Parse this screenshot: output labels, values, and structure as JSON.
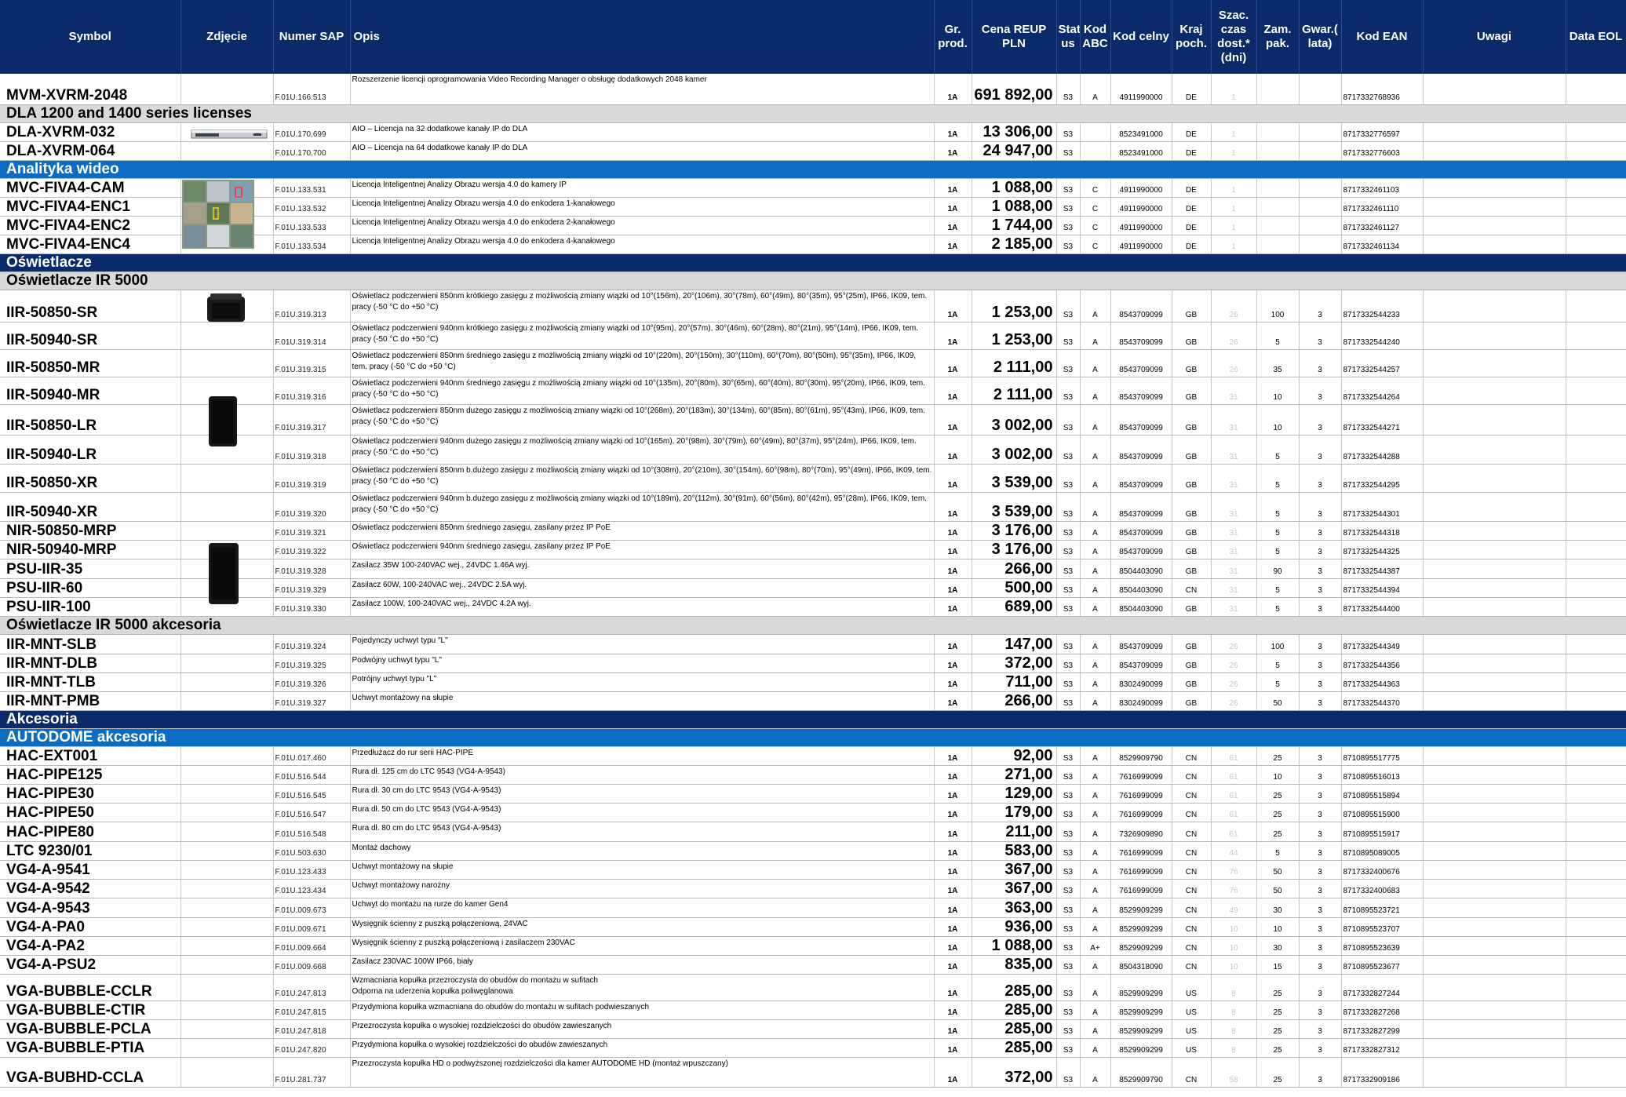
{
  "header": {
    "symbol": "Symbol",
    "photo": "Zdjęcie",
    "sap": "Numer SAP",
    "desc": "Opis",
    "group": "Gr. prod.",
    "price": "Cena REUP PLN",
    "status": "Stat us",
    "abc": "Kod ABC",
    "customs": "Kod celny",
    "country": "Kraj poch.",
    "delivery": "Szac. czas dost.* (dni)",
    "pack": "Zam. pak.",
    "warranty": "Gwar.( lata)",
    "ean": "Kod EAN",
    "notes": "Uwagi",
    "eol": "Data EOL"
  },
  "rows": [
    {
      "type": "item",
      "h": 39,
      "symbol": "MVM-XVRM-2048",
      "sap": "F.01U.166.513",
      "desc": "Rozszerzenie licencji oprogramowania Video Recording Manager o obsługę dodatkowych 2048 kamer",
      "group": "1A",
      "price": "691 892,00",
      "status": "S3",
      "abc": "A",
      "customs": "4911990000",
      "country": "DE",
      "delivery": "1",
      "pack": "",
      "warranty": "",
      "ean": "8717332768936"
    },
    {
      "type": "sec-grey",
      "h": 21,
      "label": "DLA 1200 and 1400 series licenses"
    },
    {
      "type": "item",
      "h": 24,
      "symbol": "DLA-XVRM-032",
      "sap": "F.01U.170.699",
      "desc": "AIO – Licencja na 32 dodatkowe kanały IP do DLA",
      "group": "1A",
      "price": "13 306,00",
      "status": "S3",
      "abc": "",
      "customs": "8523491000",
      "country": "DE",
      "delivery": "1",
      "pack": "",
      "warranty": "",
      "ean": "8717332776597"
    },
    {
      "type": "item",
      "h": 24,
      "symbol": "DLA-XVRM-064",
      "sap": "F.01U.170.700",
      "desc": "AIO – Licencja na 64 dodatkowe kanały IP do DLA",
      "group": "1A",
      "price": "24 947,00",
      "status": "S3",
      "abc": "",
      "customs": "8523491000",
      "country": "DE",
      "delivery": "1",
      "pack": "",
      "warranty": "",
      "ean": "8717332776603"
    },
    {
      "type": "sec-blue",
      "h": 22,
      "label": "Analityka wideo"
    },
    {
      "type": "item",
      "h": 24,
      "symbol": "MVC-FIVA4-CAM",
      "sap": "F.01U.133.531",
      "desc": "Licencja Inteligentnej Analizy Obrazu wersja 4.0 do kamery IP",
      "group": "1A",
      "price": "1 088,00",
      "status": "S3",
      "abc": "C",
      "customs": "4911990000",
      "country": "DE",
      "delivery": "1",
      "pack": "",
      "warranty": "",
      "ean": "8717332461103"
    },
    {
      "type": "item",
      "h": 24,
      "symbol": "MVC-FIVA4-ENC1",
      "sap": "F.01U.133.532",
      "desc": "Licencja Inteligentnej Analizy Obrazu wersja 4.0 do enkodera 1-kanałowego",
      "group": "1A",
      "price": "1 088,00",
      "status": "S3",
      "abc": "C",
      "customs": "4911990000",
      "country": "DE",
      "delivery": "1",
      "pack": "",
      "warranty": "",
      "ean": "8717332461110"
    },
    {
      "type": "item",
      "h": 24,
      "symbol": "MVC-FIVA4-ENC2",
      "sap": "F.01U.133.533",
      "desc": "Licencja Inteligentnej Analizy Obrazu wersja 4.0 do enkodera 2-kanałowego",
      "group": "1A",
      "price": "1 744,00",
      "status": "S3",
      "abc": "C",
      "customs": "4911990000",
      "country": "DE",
      "delivery": "1",
      "pack": "",
      "warranty": "",
      "ean": "8717332461127"
    },
    {
      "type": "item",
      "h": 24,
      "symbol": "MVC-FIVA4-ENC4",
      "sap": "F.01U.133.534",
      "desc": "Licencja Inteligentnej Analizy Obrazu wersja 4.0 do enkodera 4-kanałowego",
      "group": "1A",
      "price": "2 185,00",
      "status": "S3",
      "abc": "C",
      "customs": "4911990000",
      "country": "DE",
      "delivery": "1",
      "pack": "",
      "warranty": "",
      "ean": "8717332461134"
    },
    {
      "type": "sec-navy",
      "h": 23,
      "label": "Oświetlacze"
    },
    {
      "type": "sec-grey",
      "h": 22,
      "label": "Oświetlacze IR 5000"
    },
    {
      "type": "item",
      "h": 41,
      "symbol": "IIR-50850-SR",
      "sap": "F.01U.319.313",
      "desc": "Oświetlacz podczerwieni 850nm krótkiego zasięgu z możliwością zmiany wiązki od 10°(156m), 20°(106m), 30°(78m), 60°(49m), 80°(35m), 95°(25m), IP66, IK09, tem. pracy (-50 °C do +50 °C)",
      "group": "1A",
      "price": "1 253,00",
      "status": "S3",
      "abc": "A",
      "customs": "8543709099",
      "country": "GB",
      "delivery": "26",
      "pack": "100",
      "warranty": "3",
      "ean": "8717332544233"
    },
    {
      "type": "item",
      "h": 35,
      "symbol": "IIR-50940-SR",
      "sap": "F.01U.319.314",
      "desc": "Oświetlacz podczerwieni 940nm krótkiego zasięgu z możliwością zmiany wiązki od 10°(95m), 20°(57m), 30°(46m), 60°(28m), 80°(21m), 95°(14m), IP66, IK09, tem. pracy (-50 °C do +50 °C)",
      "group": "1A",
      "price": "1 253,00",
      "status": "S3",
      "abc": "A",
      "customs": "8543709099",
      "country": "GB",
      "delivery": "26",
      "pack": "5",
      "warranty": "3",
      "ean": "8717332544240"
    },
    {
      "type": "item",
      "h": 35,
      "symbol": "IIR-50850-MR",
      "sap": "F.01U.319.315",
      "desc": "Oświetlacz podczerwieni 850nm średniego zasięgu z możliwością zmiany wiązki od 10°(220m), 20°(150m), 30°(110m), 60°(70m), 80°(50m), 95°(35m), IP66, IK09, tem. pracy (-50 °C do +50 °C)",
      "group": "1A",
      "price": "2 111,00",
      "status": "S3",
      "abc": "A",
      "customs": "8543709099",
      "country": "GB",
      "delivery": "26",
      "pack": "35",
      "warranty": "3",
      "ean": "8717332544257"
    },
    {
      "type": "item",
      "h": 35,
      "symbol": "IIR-50940-MR",
      "sap": "F.01U.319.316",
      "desc": "Oświetlacz podczerwieni 940nm średniego zasięgu z możliwością zmiany wiązki od 10°(135m), 20°(80m), 30°(65m), 60°(40m), 80°(30m), 95°(20m), IP66, IK09, tem. pracy (-50 °C do +50 °C)",
      "group": "1A",
      "price": "2 111,00",
      "status": "S3",
      "abc": "A",
      "customs": "8543709099",
      "country": "GB",
      "delivery": "31",
      "pack": "10",
      "warranty": "3",
      "ean": "8717332544264"
    },
    {
      "type": "item",
      "h": 39,
      "symbol": "IIR-50850-LR",
      "sap": "F.01U.319.317",
      "desc": "Oświetlacz podczerwieni 850nm dużego zasięgu z możliwością zmiany wiązki od 10°(268m), 20°(183m), 30°(134m), 60°(85m), 80°(61m), 95°(43m), IP66, IK09, tem. pracy (-50 °C do +50 °C)",
      "group": "1A",
      "price": "3 002,00",
      "status": "S3",
      "abc": "A",
      "customs": "8543709099",
      "country": "GB",
      "delivery": "31",
      "pack": "10",
      "warranty": "3",
      "ean": "8717332544271"
    },
    {
      "type": "item",
      "h": 37,
      "symbol": "IIR-50940-LR",
      "sap": "F.01U.319.318",
      "desc": "Oświetlacz podczerwieni 940nm dużego zasięgu z możliwością zmiany wiązki od 10°(165m), 20°(98m), 30°(79m), 60°(49m), 80°(37m), 95°(24m), IP66, IK09, tem. pracy (-50 °C do +50 °C)",
      "group": "1A",
      "price": "3 002,00",
      "status": "S3",
      "abc": "A",
      "customs": "8543709099",
      "country": "GB",
      "delivery": "31",
      "pack": "5",
      "warranty": "3",
      "ean": "8717332544288"
    },
    {
      "type": "item",
      "h": 36,
      "symbol": "IIR-50850-XR",
      "sap": "F.01U.319.319",
      "desc": "Oświetlacz podczerwieni 850nm b.dużego zasięgu z możliwością zmiany wiązki od 10°(308m), 20°(210m), 30°(154m), 60°(98m), 80°(70m), 95°(49m), IP66, IK09, tem. pracy (-50 °C do +50 °C)",
      "group": "1A",
      "price": "3 539,00",
      "status": "S3",
      "abc": "A",
      "customs": "8543709099",
      "country": "GB",
      "delivery": "31",
      "pack": "5",
      "warranty": "3",
      "ean": "8717332544295"
    },
    {
      "type": "item",
      "h": 37,
      "symbol": "IIR-50940-XR",
      "sap": "F.01U.319.320",
      "desc": "Oświetlacz podczerwieni 940nm b.dużego zasięgu z możliwością zmiany wiązki od 10°(189m), 20°(112m), 30°(91m), 60°(56m), 80°(42m), 95°(28m), IP66, IK09, tem. pracy (-50 °C do +50 °C)",
      "group": "1A",
      "price": "3 539,00",
      "status": "S3",
      "abc": "A",
      "customs": "8543709099",
      "country": "GB",
      "delivery": "31",
      "pack": "5",
      "warranty": "3",
      "ean": "8717332544301"
    },
    {
      "type": "item",
      "h": 23,
      "symbol": "NIR-50850-MRP",
      "sap": "F.01U.319.321",
      "desc": "Oświetlacz podczerwieni 850nm średniego zasięgu, zasilany przez IP PoE",
      "group": "1A",
      "price": "3 176,00",
      "status": "S3",
      "abc": "A",
      "customs": "8543709099",
      "country": "GB",
      "delivery": "31",
      "pack": "5",
      "warranty": "3",
      "ean": "8717332544318"
    },
    {
      "type": "item",
      "h": 24,
      "symbol": "NIR-50940-MRP",
      "sap": "F.01U.319.322",
      "desc": "Oświetlacz podczerwieni 940nm średniego zasięgu, zasilany przez IP PoE",
      "group": "1A",
      "price": "3 176,00",
      "status": "S3",
      "abc": "A",
      "customs": "8543709099",
      "country": "GB",
      "delivery": "31",
      "pack": "5",
      "warranty": "3",
      "ean": "8717332544325"
    },
    {
      "type": "item",
      "h": 25,
      "symbol": "PSU-IIR-35",
      "sap": "F.01U.319.328",
      "desc": "Zasilacz 35W 100-240VAC wej., 24VDC 1.46A wyj.",
      "group": "1A",
      "price": "266,00",
      "status": "S3",
      "abc": "A",
      "customs": "8504403090",
      "country": "GB",
      "delivery": "31",
      "pack": "90",
      "warranty": "3",
      "ean": "8717332544387"
    },
    {
      "type": "item",
      "h": 24,
      "symbol": "PSU-IIR-60",
      "sap": "F.01U.319.329",
      "desc": "Zasilacz 60W, 100-240VAC wej., 24VDC 2.5A wyj.",
      "group": "1A",
      "price": "500,00",
      "status": "S3",
      "abc": "A",
      "customs": "8504403090",
      "country": "CN",
      "delivery": "31",
      "pack": "5",
      "warranty": "3",
      "ean": "8717332544394"
    },
    {
      "type": "item",
      "h": 24,
      "symbol": "PSU-IIR-100",
      "sap": "F.01U.319.330",
      "desc": "Zasilacz 100W, 100-240VAC wej.,  24VDC 4.2A wyj.",
      "group": "1A",
      "price": "689,00",
      "status": "S3",
      "abc": "A",
      "customs": "8504403090",
      "country": "GB",
      "delivery": "31",
      "pack": "5",
      "warranty": "3",
      "ean": "8717332544400"
    },
    {
      "type": "sec-grey",
      "h": 22,
      "label": "Oświetlacze IR 5000 akcesoria"
    },
    {
      "type": "item",
      "h": 25,
      "symbol": "IIR-MNT-SLB",
      "sap": "F.01U.319.324",
      "desc": "Pojedynczy uchwyt typu \"L\"",
      "group": "1A",
      "price": "147,00",
      "status": "S3",
      "abc": "A",
      "customs": "8543709099",
      "country": "GB",
      "delivery": "26",
      "pack": "100",
      "warranty": "3",
      "ean": "8717332544349"
    },
    {
      "type": "item",
      "h": 24,
      "symbol": "IIR-MNT-DLB",
      "sap": "F.01U.319.325",
      "desc": "Podwójny uchwyt typu \"L\"",
      "group": "1A",
      "price": "372,00",
      "status": "S3",
      "abc": "A",
      "customs": "8543709099",
      "country": "GB",
      "delivery": "26",
      "pack": "5",
      "warranty": "3",
      "ean": "8717332544356"
    },
    {
      "type": "item",
      "h": 24,
      "symbol": "IIR-MNT-TLB",
      "sap": "F.01U.319.326",
      "desc": "Potrójny uchwyt typu \"L\"",
      "group": "1A",
      "price": "711,00",
      "status": "S3",
      "abc": "A",
      "customs": "8302490099",
      "country": "GB",
      "delivery": "26",
      "pack": "5",
      "warranty": "3",
      "ean": "8717332544363"
    },
    {
      "type": "item",
      "h": 24,
      "symbol": "IIR-MNT-PMB",
      "sap": "F.01U.319.327",
      "desc": "Uchwyt montażowy na słupie",
      "group": "1A",
      "price": "266,00",
      "status": "S3",
      "abc": "A",
      "customs": "8302490099",
      "country": "GB",
      "delivery": "26",
      "pack": "50",
      "warranty": "3",
      "ean": "8717332544370"
    },
    {
      "type": "sec-navy",
      "h": 22,
      "label": "Akcesoria"
    },
    {
      "type": "sec-blue",
      "h": 23,
      "label": "AUTODOME akcesoria"
    },
    {
      "type": "item",
      "h": 24,
      "symbol": "HAC-EXT001",
      "sap": "F.01U.017.460",
      "desc": "Przedłużacz do rur serii HAC-PIPE",
      "group": "1A",
      "price": "92,00",
      "status": "S3",
      "abc": "A",
      "customs": "8529909790",
      "country": "CN",
      "delivery": "61",
      "pack": "25",
      "warranty": "3",
      "ean": "8710895517775"
    },
    {
      "type": "item",
      "h": 24,
      "symbol": "HAC-PIPE125",
      "sap": "F.01U.516.544",
      "desc": "Rura dł. 125 cm do LTC 9543 (VG4-A-9543)",
      "group": "1A",
      "price": "271,00",
      "status": "S3",
      "abc": "A",
      "customs": "7616999099",
      "country": "CN",
      "delivery": "61",
      "pack": "10",
      "warranty": "3",
      "ean": "8710895516013"
    },
    {
      "type": "item",
      "h": 24,
      "symbol": "HAC-PIPE30",
      "sap": "F.01U.516.545",
      "desc": "Rura dł. 30 cm do LTC 9543 (VG4-A-9543)",
      "group": "1A",
      "price": "129,00",
      "status": "S3",
      "abc": "A",
      "customs": "7616999099",
      "country": "CN",
      "delivery": "61",
      "pack": "25",
      "warranty": "3",
      "ean": "8710895515894"
    },
    {
      "type": "item",
      "h": 24,
      "symbol": "HAC-PIPE50",
      "sap": "F.01U.516.547",
      "desc": "Rura dł. 50 cm do LTC 9543 (VG4-A-9543)",
      "group": "1A",
      "price": "179,00",
      "status": "S3",
      "abc": "A",
      "customs": "7616999099",
      "country": "CN",
      "delivery": "61",
      "pack": "25",
      "warranty": "3",
      "ean": "8710895515900"
    },
    {
      "type": "item",
      "h": 25,
      "symbol": "HAC-PIPE80",
      "sap": "F.01U.516.548",
      "desc": "Rura dł. 80 cm do LTC 9543 (VG4-A-9543)",
      "group": "1A",
      "price": "211,00",
      "status": "S3",
      "abc": "A",
      "customs": "7326909890",
      "country": "CN",
      "delivery": "61",
      "pack": "25",
      "warranty": "3",
      "ean": "8710895515917"
    },
    {
      "type": "item",
      "h": 24,
      "symbol": "LTC 9230/01",
      "sap": "F.01U.503.630",
      "desc": "Montaż dachowy",
      "group": "1A",
      "price": "583,00",
      "status": "S3",
      "abc": "A",
      "customs": "7616999099",
      "country": "CN",
      "delivery": "44",
      "pack": "5",
      "warranty": "3",
      "ean": "8710895089005"
    },
    {
      "type": "item",
      "h": 24,
      "symbol": "VG4-A-9541",
      "sap": "F.01U.123.433",
      "desc": "Uchwyt montażowy na słupie",
      "group": "1A",
      "price": "367,00",
      "status": "S3",
      "abc": "A",
      "customs": "7616999099",
      "country": "CN",
      "delivery": "76",
      "pack": "50",
      "warranty": "3",
      "ean": "8717332400676"
    },
    {
      "type": "item",
      "h": 24,
      "symbol": "VG4-A-9542",
      "sap": "F.01U.123.434",
      "desc": "Uchwyt montażowy narożny",
      "group": "1A",
      "price": "367,00",
      "status": "S3",
      "abc": "A",
      "customs": "7616999099",
      "country": "CN",
      "delivery": "76",
      "pack": "50",
      "warranty": "3",
      "ean": "8717332400683"
    },
    {
      "type": "item",
      "h": 25,
      "symbol": "VG4-A-9543",
      "sap": "F.01U.009.673",
      "desc": "Uchwyt do montażu na rurze do kamer Gen4",
      "group": "1A",
      "price": "363,00",
      "status": "S3",
      "abc": "A",
      "customs": "8529909299",
      "country": "CN",
      "delivery": "49",
      "pack": "30",
      "warranty": "3",
      "ean": "8710895523721"
    },
    {
      "type": "item",
      "h": 24,
      "symbol": "VG4-A-PA0",
      "sap": "F.01U.009.671",
      "desc": "Wysięgnik ścienny z puszką połączeniową, 24VAC",
      "group": "1A",
      "price": "936,00",
      "status": "S3",
      "abc": "A",
      "customs": "8529909299",
      "country": "CN",
      "delivery": "10",
      "pack": "10",
      "warranty": "3",
      "ean": "8710895523707"
    },
    {
      "type": "item",
      "h": 24,
      "symbol": "VG4-A-PA2",
      "sap": "F.01U.009.664",
      "desc": "Wysięgnik ścienny z puszką połączeniową i zasilaczem 230VAC",
      "group": "1A",
      "price": "1 088,00",
      "status": "S3",
      "abc": "A+",
      "customs": "8529909299",
      "country": "CN",
      "delivery": "10",
      "pack": "30",
      "warranty": "3",
      "ean": "8710895523639"
    },
    {
      "type": "item",
      "h": 24,
      "symbol": "VG4-A-PSU2",
      "sap": "F.01U.009.668",
      "desc": "Zasilacz 230VAC 100W IP66, biały",
      "group": "1A",
      "price": "835,00",
      "status": "S3",
      "abc": "A",
      "customs": "8504318090",
      "country": "CN",
      "delivery": "10",
      "pack": "15",
      "warranty": "3",
      "ean": "8710895523677"
    },
    {
      "type": "item",
      "h": 34,
      "symbol": "VGA-BUBBLE-CCLR",
      "sap": "F.01U.247.813",
      "desc": "Wzmacniana kopułka przezroczysta do obudów do montażu w sufitach\nOdporna na uderzenia kopułka poliwęglanowa",
      "group": "1A",
      "price": "285,00",
      "status": "S3",
      "abc": "A",
      "customs": "8529909299",
      "country": "US",
      "delivery": "8",
      "pack": "25",
      "warranty": "3",
      "ean": "8717332827244"
    },
    {
      "type": "item",
      "h": 24,
      "symbol": "VGA-BUBBLE-CTIR",
      "sap": "F.01U.247.815",
      "desc": "Przydymiona kopułka wzmacniana do obudów do montażu w sufitach podwieszanych",
      "group": "1A",
      "price": "285,00",
      "status": "S3",
      "abc": "A",
      "customs": "8529909299",
      "country": "US",
      "delivery": "8",
      "pack": "25",
      "warranty": "3",
      "ean": "8717332827268"
    },
    {
      "type": "item",
      "h": 24,
      "symbol": "VGA-BUBBLE-PCLA",
      "sap": "F.01U.247.818",
      "desc": "Przezroczysta kopułka o wysokiej rozdzielczości do obudów zawieszanych",
      "group": "1A",
      "price": "285,00",
      "status": "S3",
      "abc": "A",
      "customs": "8529909299",
      "country": "US",
      "delivery": "8",
      "pack": "25",
      "warranty": "3",
      "ean": "8717332827299"
    },
    {
      "type": "item",
      "h": 24,
      "symbol": "VGA-BUBBLE-PTIA",
      "sap": "F.01U.247.820",
      "desc": "Przydymiona kopułka o wysokiej rozdzielczości do obudów zawieszanych",
      "group": "1A",
      "price": "285,00",
      "status": "S3",
      "abc": "A",
      "customs": "8529909299",
      "country": "US",
      "delivery": "8",
      "pack": "25",
      "warranty": "3",
      "ean": "8717332827312"
    },
    {
      "type": "item",
      "h": 38,
      "symbol": "VGA-BUBHD-CCLA",
      "sap": "F.01U.281.737",
      "desc": "Przezroczysta kopułka HD o podwyższonej rozdzielczości dla kamer  AUTODOME HD (montaż wpuszczany)",
      "group": "1A",
      "price": "372,00",
      "status": "S3",
      "abc": "A",
      "customs": "8529909790",
      "country": "CN",
      "delivery": "58",
      "pack": "25",
      "warranty": "3",
      "ean": "8717332909186"
    }
  ]
}
